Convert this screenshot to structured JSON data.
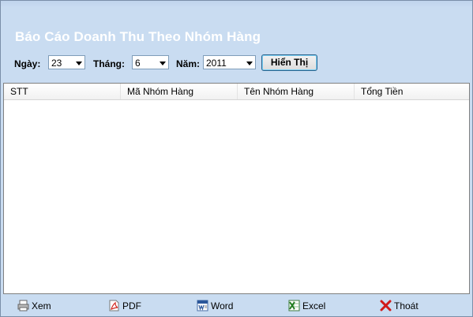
{
  "title": "Báo Cáo Doanh Thu Theo Nhóm Hàng",
  "filters": {
    "day_label": "Ngày:",
    "day_value": "23",
    "month_label": "Tháng:",
    "month_value": "6",
    "year_label": "Năm:",
    "year_value": "2011",
    "show_button": "Hiển Thị"
  },
  "table": {
    "columns": [
      "STT",
      "Mã Nhóm Hàng",
      "Tên Nhóm Hàng",
      "Tổng Tiền"
    ]
  },
  "toolbar": {
    "view": "Xem",
    "pdf": "PDF",
    "word": "Word",
    "excel": "Excel",
    "exit": "Thoát"
  },
  "icons": {
    "view": "printer-icon",
    "pdf": "pdf-icon",
    "word": "word-icon",
    "excel": "excel-icon",
    "exit": "close-icon"
  }
}
